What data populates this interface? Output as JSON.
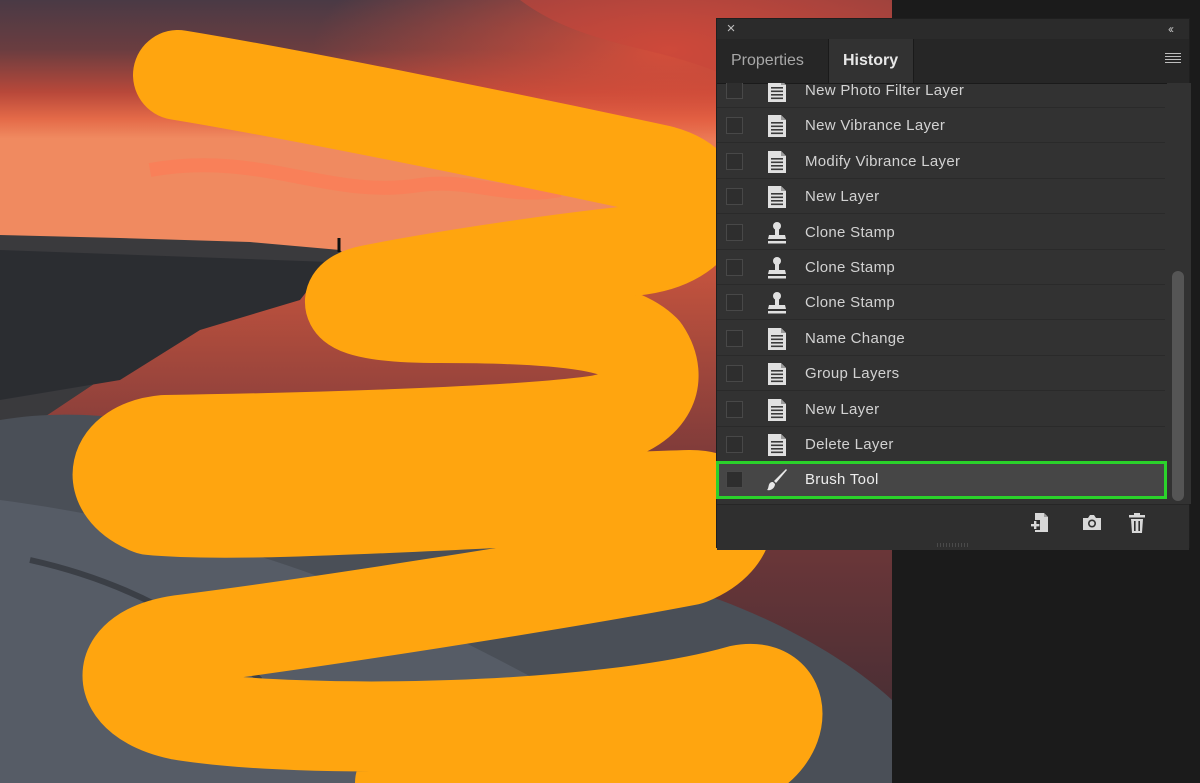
{
  "panel": {
    "tabs": [
      {
        "label": "Properties",
        "active": false
      },
      {
        "label": "History",
        "active": true
      }
    ],
    "close_glyph": "×",
    "collapse_glyph": "‹‹",
    "history_items": [
      {
        "label": "New Photo Filter Layer",
        "icon": "document-icon"
      },
      {
        "label": "New Vibrance Layer",
        "icon": "document-icon"
      },
      {
        "label": "Modify Vibrance Layer",
        "icon": "document-icon"
      },
      {
        "label": "New Layer",
        "icon": "document-icon"
      },
      {
        "label": "Clone Stamp",
        "icon": "clone-stamp-icon"
      },
      {
        "label": "Clone Stamp",
        "icon": "clone-stamp-icon"
      },
      {
        "label": "Clone Stamp",
        "icon": "clone-stamp-icon"
      },
      {
        "label": "Name Change",
        "icon": "document-icon"
      },
      {
        "label": "Group Layers",
        "icon": "document-icon"
      },
      {
        "label": "New Layer",
        "icon": "document-icon"
      },
      {
        "label": "Delete Layer",
        "icon": "document-icon"
      },
      {
        "label": "Brush Tool",
        "icon": "brush-icon",
        "selected": true
      }
    ],
    "bottom_icons": [
      "new-document-from-state-icon",
      "snapshot-camera-icon",
      "trash-icon"
    ]
  },
  "colors": {
    "brush_stroke": "#ffa50f",
    "selection_outline": "#2bd22b",
    "panel_bg": "#323232"
  }
}
